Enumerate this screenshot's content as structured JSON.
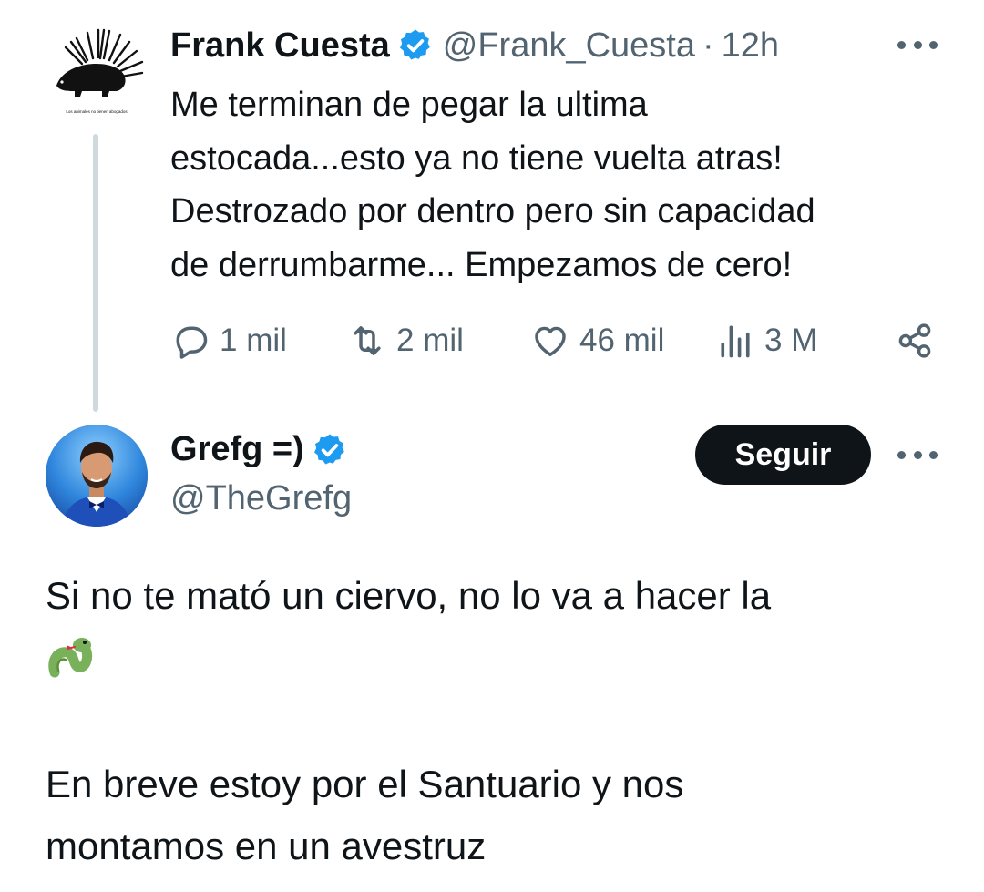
{
  "quoted_tweet": {
    "avatar_caption": "Los animales no tienen abogados",
    "name": "Frank Cuesta",
    "handle": "@Frank_Cuesta",
    "separator": "·",
    "time": "12h",
    "text": "Me terminan de pegar la ultima estocada...esto ya no tiene vuelta atras! Destrozado por dentro pero sin capacidad de derrumbarme... Empezamos de cero!",
    "text_lines": [
      "Me terminan de pegar la ultima",
      "estocada...esto ya no tiene vuelta atras!",
      "Destrozado por dentro pero sin capacidad",
      "de derrumbarme... Empezamos de cero!"
    ],
    "stats": {
      "replies": "1 mil",
      "retweets": "2 mil",
      "likes": "46 mil",
      "views": "3 M"
    }
  },
  "main_tweet": {
    "name": "Grefg =)",
    "handle": "@TheGrefg",
    "follow_label": "Seguir",
    "text_lines": [
      "Si no te mató un ciervo, no lo va a hacer la",
      "En breve estoy por el Santuario y nos",
      "montamos en un avestruz"
    ],
    "emoji": "snake"
  },
  "colors": {
    "text_primary": "#0f1419",
    "text_secondary": "#536471",
    "verified_blue": "#1d9bf0",
    "thread_line": "#cfd9de",
    "follow_bg": "#0f1419"
  },
  "icons": [
    "porcupine-logo",
    "verified-badge-icon",
    "more-icon",
    "reply-icon",
    "retweet-icon",
    "like-icon",
    "views-icon",
    "share-icon",
    "snake-emoji"
  ]
}
